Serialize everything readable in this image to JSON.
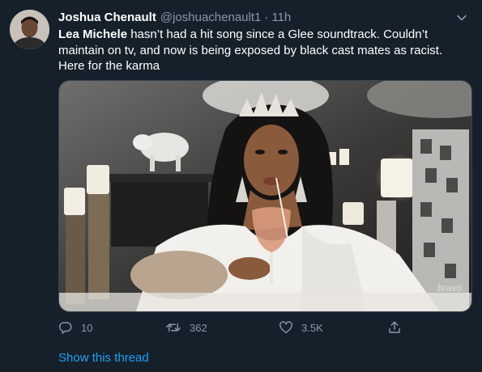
{
  "tweet": {
    "author_name": "Joshua Chenault",
    "handle": "@joshuachenault1",
    "separator": "·",
    "time": "11h",
    "text_mention": "Lea Michele",
    "text_rest": " hasn’t had a hit song since a Glee soundtrack. Couldn’t maintain on tv, and now is being exposed by black cast mates as racist. Here for the karma",
    "media_watermark": "bravo",
    "show_thread": "Show this thread"
  },
  "actions": {
    "replies": "10",
    "retweets": "362",
    "likes": "3.5K"
  },
  "icons": {
    "caret": "chevron-down-icon",
    "reply": "reply-icon",
    "retweet": "retweet-icon",
    "like": "heart-icon",
    "share": "share-icon"
  },
  "colors": {
    "background": "#15202b",
    "secondary_text": "#8899a6",
    "link": "#1da1f2",
    "border": "#38444d"
  }
}
